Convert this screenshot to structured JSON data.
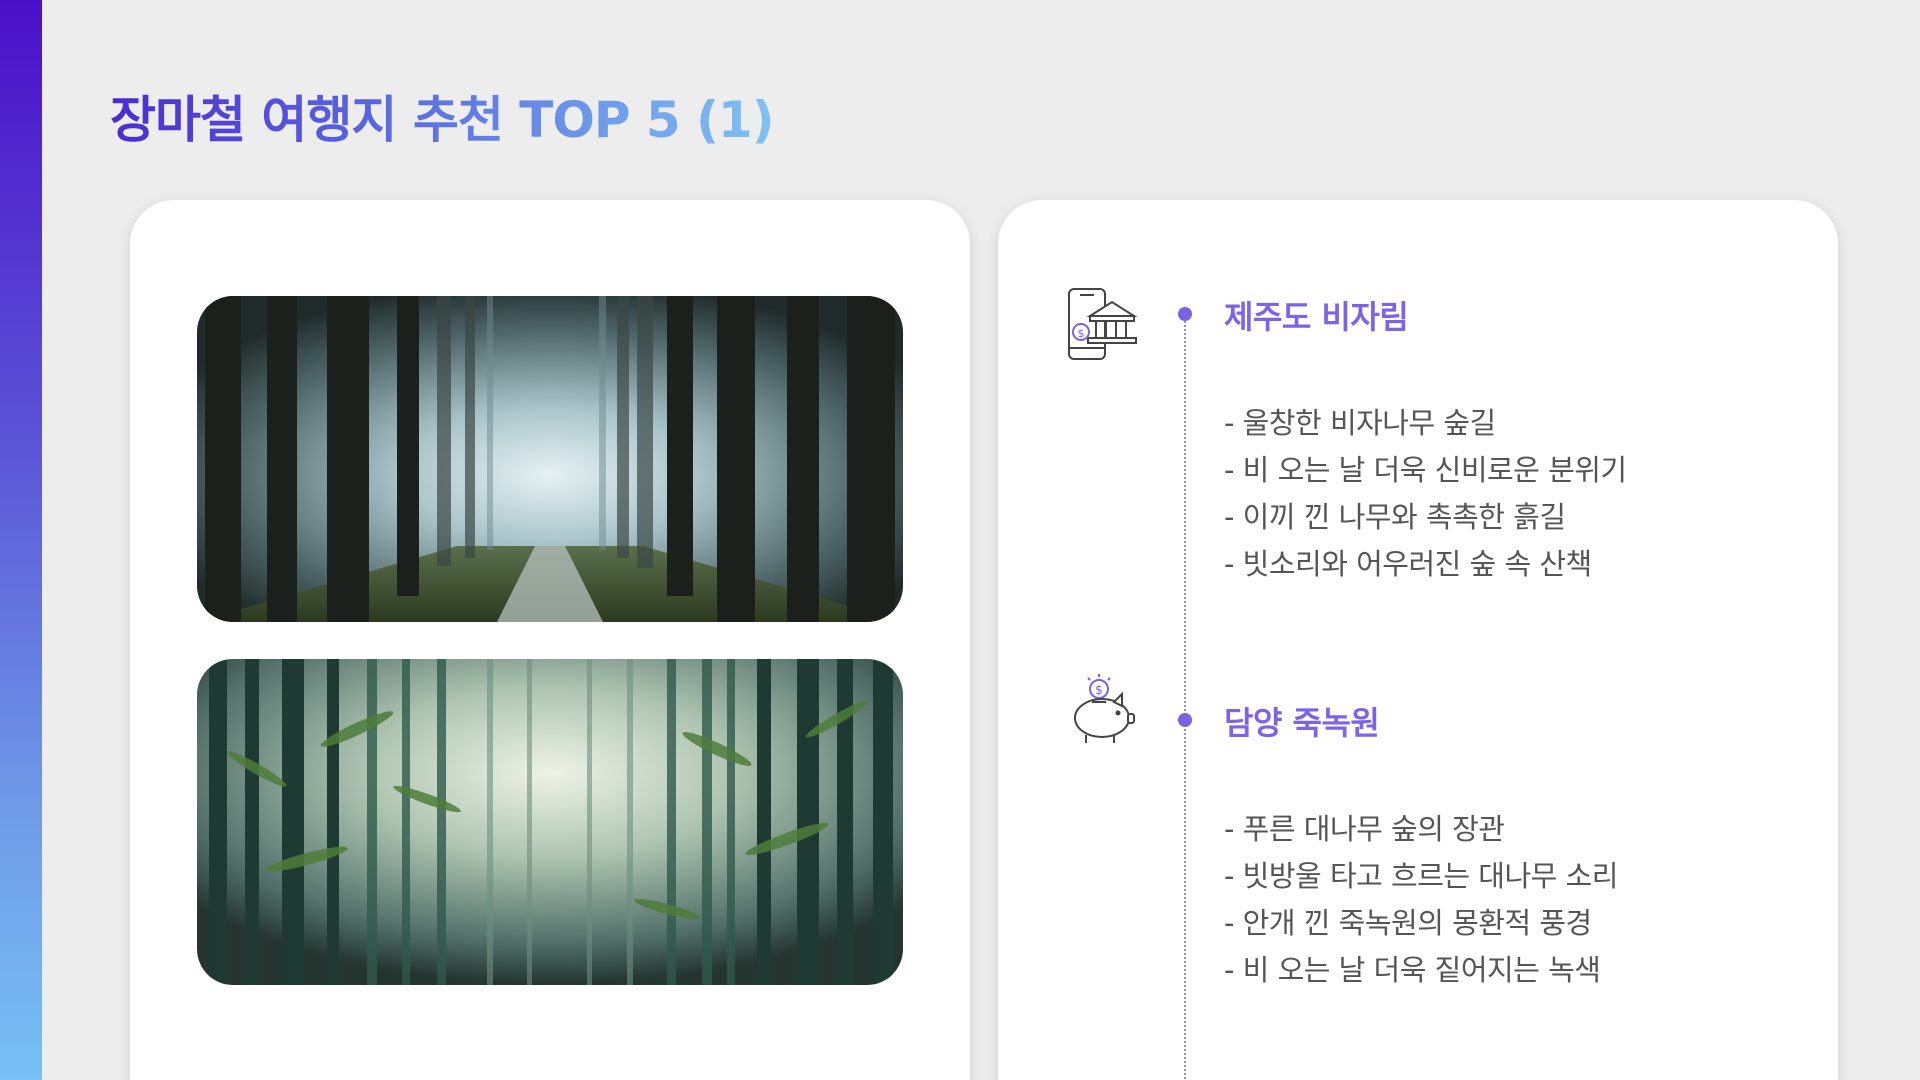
{
  "title": "장마철 여행지 추천 TOP 5 (1)",
  "colors": {
    "accent_gradient": [
      "#4a10c8",
      "#78c0f5"
    ],
    "section_title": "#7c63ea",
    "timeline": "#9a86e8",
    "body_text": "#555555",
    "background": "#ededed"
  },
  "images": [
    {
      "name": "foggy-forest-path-photo",
      "subject": "misty forest path"
    },
    {
      "name": "bamboo-forest-photo",
      "subject": "bamboo forest"
    }
  ],
  "sections": [
    {
      "icon": "mobile-bank-icon",
      "title": "제주도 비자림",
      "bullets": [
        "- 울창한 비자나무 숲길",
        "- 비 오는 날 더욱 신비로운 분위기",
        "- 이끼 낀 나무와 촉촉한 흙길",
        "- 빗소리와 어우러진 숲 속 산책"
      ]
    },
    {
      "icon": "piggy-bank-icon",
      "title": "담양 죽녹원",
      "bullets": [
        "- 푸른 대나무 숲의 장관",
        "- 빗방울 타고 흐르는 대나무 소리",
        "- 안개 낀 죽녹원의 몽환적 풍경",
        "- 비 오는 날 더욱 짙어지는 녹색"
      ]
    }
  ]
}
